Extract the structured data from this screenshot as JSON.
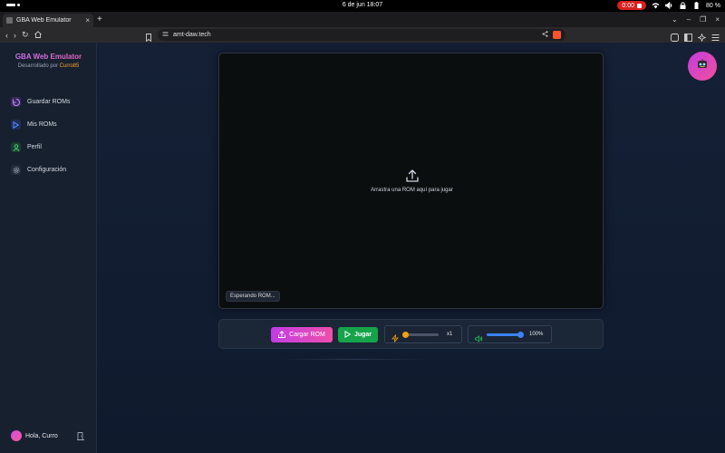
{
  "system": {
    "clock": "6 de jun  18:07",
    "recording_time": "0:00",
    "battery": "80 %"
  },
  "browser": {
    "tab_title": "GBA Web Emulator",
    "url": "amt-daw.tech"
  },
  "sidebar": {
    "brand_title": "GBA Web Emulator",
    "brand_sub_prefix": "Desarrollado por ",
    "brand_author": "Curro85",
    "items": [
      {
        "label": "Guardar ROMs",
        "icon": "save-icon"
      },
      {
        "label": "Mis ROMs",
        "icon": "play-icon"
      },
      {
        "label": "Perfil",
        "icon": "user-icon"
      },
      {
        "label": "Configuración",
        "icon": "gear-icon"
      }
    ],
    "user_greeting": "Hola, Curro"
  },
  "emulator": {
    "drop_text": "Arrastra una ROM aquí para jugar",
    "status": "Esperando ROM..."
  },
  "controls": {
    "load_label": "Cargar ROM",
    "play_label": "Jugar",
    "speed_label": "x1",
    "speed_level": 0,
    "volume_label": "100%",
    "volume_level": 1
  },
  "colors": {
    "accent": "#d946ef",
    "play": "#16a34a",
    "speed": "#f59e0b",
    "volume": "#3b82f6"
  }
}
